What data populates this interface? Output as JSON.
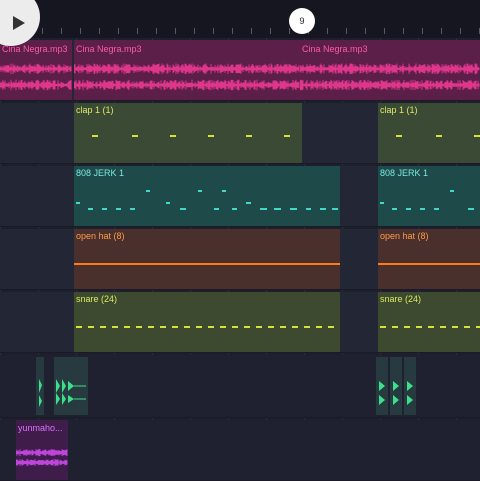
{
  "playhead": {
    "bar": "9"
  },
  "audio_track": {
    "clip_labels": [
      "Cina Negra.mp3",
      "Cina Negra.mp3",
      "Cina Negra.mp3"
    ],
    "color": "#ff3d9a"
  },
  "patterns": {
    "clap": {
      "label": "clap 1 (1)",
      "color": "#d4e23a"
    },
    "kick808": {
      "label": "808 JERK 1",
      "color": "#40d8c8"
    },
    "hat": {
      "label": "open hat (8)",
      "color": "#ff7a1a"
    },
    "snare": {
      "label": "snare (24)",
      "color": "#d4e23a"
    }
  },
  "bottom_clip": {
    "label": "yunmaho..."
  },
  "icons": {
    "play": "play-icon"
  }
}
